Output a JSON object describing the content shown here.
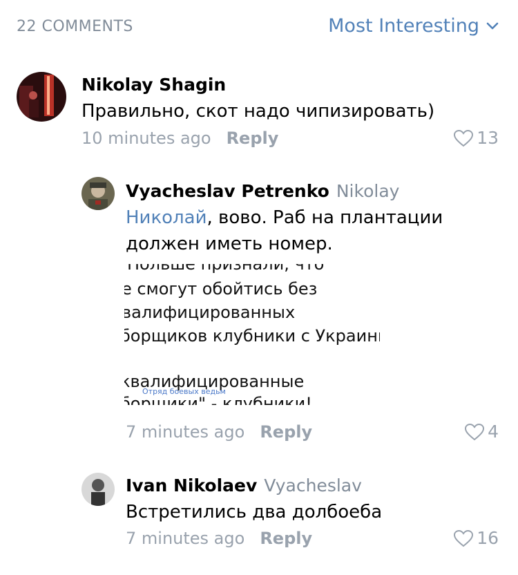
{
  "header": {
    "count_label": "22 COMMENTS",
    "sort_label": "Most Interesting",
    "sort_icon": "chevron-down-icon"
  },
  "colors": {
    "accent": "#5181b8",
    "muted": "#99a2ad",
    "header_gray": "#818c99"
  },
  "comments": [
    {
      "name": "Nikolay Shagin",
      "text": "Правильно, скот надо чипизировать)",
      "time": "10 minutes ago",
      "reply_label": "Reply",
      "likes": "13"
    },
    {
      "name": "Vyacheslav Petrenko",
      "reply_to": "Nikolay",
      "mention": "Николай",
      "text": ", вово. Раб на плантации должен иметь номер.",
      "attachment_lines": [
        "Польше признали, что",
        "е смогут обойтись без",
        "валифицированных",
        "борщиков клубники с Украины",
        "квалифицированные",
        "борщики\" - клубники!"
      ],
      "attachment_watermark": "Отряд боевых ведьм",
      "time": "7 minutes ago",
      "reply_label": "Reply",
      "likes": "4"
    },
    {
      "name": "Ivan Nikolaev",
      "reply_to": "Vyacheslav",
      "text": "Встретились два долбоеба",
      "time": "7 minutes ago",
      "reply_label": "Reply",
      "likes": "16"
    }
  ]
}
